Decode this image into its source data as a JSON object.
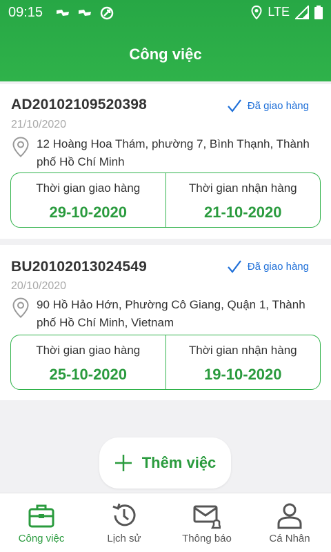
{
  "status_bar": {
    "time": "09:15",
    "network": "LTE"
  },
  "header": {
    "title": "Công việc"
  },
  "orders": [
    {
      "code": "AD20102109520398",
      "date": "21/10/2020",
      "status": "Đã giao hàng",
      "address": "12 Hoàng Hoa Thám, phường 7, Bình Thạnh, Thành phố Hồ Chí Minh",
      "delivery_label": "Thời gian giao hàng",
      "delivery_date": "29-10-2020",
      "receive_label": "Thời gian nhận hàng",
      "receive_date": "21-10-2020"
    },
    {
      "code": "BU20102013024549",
      "date": "20/10/2020",
      "status": "Đã giao hàng",
      "address": "90 Hồ Hảo Hớn, Phường Cô Giang, Quận 1, Thành phố Hồ Chí Minh, Vietnam",
      "delivery_label": "Thời gian giao hàng",
      "delivery_date": "25-10-2020",
      "receive_label": "Thời gian nhận hàng",
      "receive_date": "19-10-2020"
    }
  ],
  "add_button": {
    "label": "Thêm việc",
    "icon": "plus-icon"
  },
  "bottom_nav": [
    {
      "label": "Công việc",
      "icon": "briefcase-icon",
      "active": true
    },
    {
      "label": "Lịch sử",
      "icon": "history-icon",
      "active": false
    },
    {
      "label": "Thông báo",
      "icon": "mail-bell-icon",
      "active": false
    },
    {
      "label": "Cá Nhân",
      "icon": "person-icon",
      "active": false
    }
  ],
  "colors": {
    "primary": "#2fb24a",
    "accent_blue": "#1e6fd8",
    "date_green": "#2a9b3e"
  }
}
